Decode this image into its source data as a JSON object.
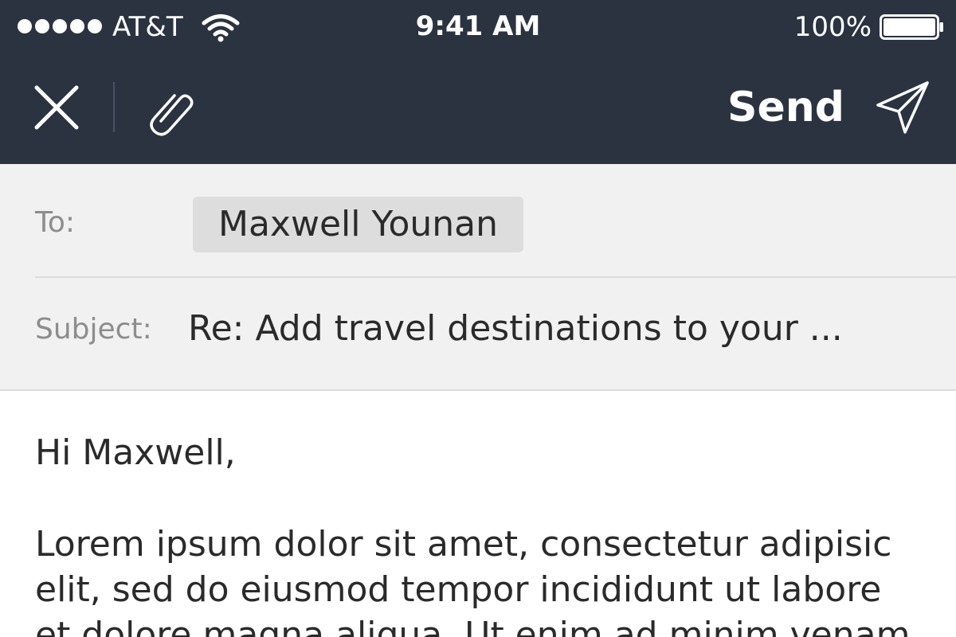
{
  "colors": {
    "header_dark": "#2b3341",
    "fields_background": "#f1f1f1",
    "recipient_chip": "#dddddd"
  },
  "status_bar": {
    "carrier": "AT&T",
    "time": "9:41 AM",
    "battery": "100%",
    "icons": [
      "signal-dots-icon",
      "wifi-icon",
      "battery-icon"
    ]
  },
  "nav": {
    "close_icon": "close-icon",
    "attach_icon": "paperclip-icon",
    "send_label": "Send",
    "send_icon": "paper-plane-icon"
  },
  "compose": {
    "to_label": "To:",
    "recipient": "Maxwell Younan",
    "subject_label": "Subject:",
    "subject": "Re: Add travel destinations to your ..."
  },
  "body": {
    "greeting": "Hi Maxwell,",
    "lines": [
      "Lorem ipsum dolor sit amet, consectetur adipisic",
      "elit, sed do eiusmod tempor incididunt ut labore",
      "et dolore magna aliqua. Ut enim ad minim venam"
    ]
  }
}
